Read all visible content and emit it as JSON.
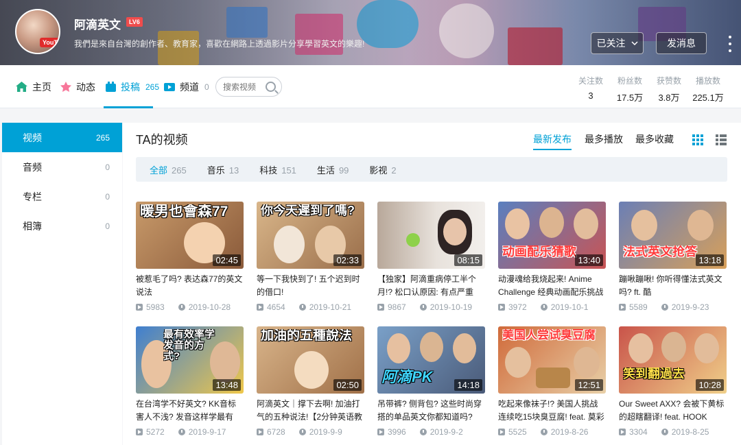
{
  "header": {
    "username": "阿滴英文",
    "level": "LV6",
    "bio": "我們是來自台灣的創作者、教育家，喜歡在網路上透過影片分享學習英文的樂趣!",
    "avatar_badge": "YouTube",
    "follow_label": "已关注",
    "message_label": "发消息",
    "colors": {
      "accent": "#00a1d6",
      "level_badge": "#f04c4c"
    }
  },
  "nav": {
    "tabs": [
      {
        "label": "主页",
        "count": "",
        "icon": "home-icon"
      },
      {
        "label": "动态",
        "count": "",
        "icon": "dynamic-icon"
      },
      {
        "label": "投稿",
        "count": "265",
        "icon": "upload-icon",
        "active": true
      },
      {
        "label": "频道",
        "count": "0",
        "icon": "channel-icon"
      }
    ],
    "search_placeholder": "搜索视频",
    "stats": [
      {
        "label": "关注数",
        "value": "3"
      },
      {
        "label": "粉丝数",
        "value": "17.5万"
      },
      {
        "label": "获赞数",
        "value": "3.8万"
      },
      {
        "label": "播放数",
        "value": "225.1万"
      }
    ]
  },
  "sidebar": {
    "items": [
      {
        "label": "视频",
        "count": "265",
        "active": true
      },
      {
        "label": "音频",
        "count": "0"
      },
      {
        "label": "专栏",
        "count": "0"
      },
      {
        "label": "相簿",
        "count": "0"
      }
    ]
  },
  "main": {
    "title": "TA的视频",
    "orders": [
      "最新发布",
      "最多播放",
      "最多收藏"
    ],
    "filters": [
      {
        "label": "全部",
        "count": "265"
      },
      {
        "label": "音乐",
        "count": "13"
      },
      {
        "label": "科技",
        "count": "151"
      },
      {
        "label": "生活",
        "count": "99"
      },
      {
        "label": "影视",
        "count": "2"
      }
    ],
    "videos": [
      {
        "thumb_text": "暖男也會森77",
        "duration": "02:45",
        "title": "被惹毛了吗? 表达森77的英文说法",
        "plays": "5983",
        "date": "2019-10-28"
      },
      {
        "thumb_text": "你今天遲到了嗎?",
        "duration": "02:33",
        "title": "等一下我快到了! 五个迟到时的借口!",
        "plays": "4654",
        "date": "2019-10-21"
      },
      {
        "thumb_text": "",
        "duration": "08:15",
        "title": "【独家】阿滴重病停工半个月!? 松口认原因: 有点严重",
        "plays": "9867",
        "date": "2019-10-19"
      },
      {
        "thumb_text": "动画配乐猜歌",
        "duration": "13:40",
        "title": "动漫魂给我烧起来! Anime Challenge 经典动画配乐挑战",
        "plays": "3972",
        "date": "2019-10-1"
      },
      {
        "thumb_text": "法式英文抢答",
        "duration": "13:18",
        "title": "蹦啾蹦啾! 你听得懂法式英文吗? ft. 酷",
        "plays": "5589",
        "date": "2019-9-23"
      },
      {
        "thumb_text": "最有效率学发音的方式?",
        "duration": "13:48",
        "title": "在台湾学不好英文? KK音标害人不浅? 发音这样学最有效!",
        "plays": "5272",
        "date": "2019-9-17"
      },
      {
        "thumb_text": "加油的五種說法",
        "duration": "02:50",
        "title": "阿滴英文｜撑下去啊! 加油打气的五种说法!【2分钟英语教",
        "plays": "6728",
        "date": "2019-9-9"
      },
      {
        "thumb_text": "阿滴PK",
        "duration": "14:18",
        "title": "吊带裤? 侧背包? 这些时尚穿搭的单品英文你都知道吗?",
        "plays": "3996",
        "date": "2019-9-2"
      },
      {
        "thumb_text": "美国人尝试臭豆腐",
        "duration": "12:51",
        "title": "吃起来像袜子!? 美国人挑战连续吃15块臭豆腐! feat. 莫彩",
        "plays": "5525",
        "date": "2019-8-26"
      },
      {
        "thumb_text": "笑到翻過去",
        "duration": "10:28",
        "title": "Our Sweet AXX? 会被下黄标的超瞎翻译! feat. HOOK",
        "plays": "3304",
        "date": "2019-8-25"
      }
    ]
  }
}
